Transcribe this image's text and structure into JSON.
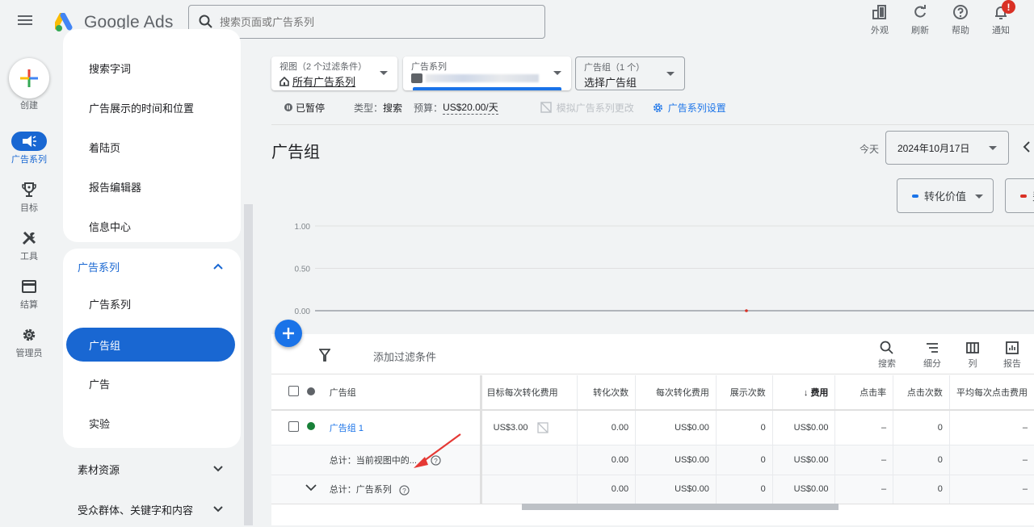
{
  "header": {
    "app_name": "Google Ads",
    "search_placeholder": "搜索页面或广告系列",
    "actions": [
      {
        "label": "外观",
        "icon": "appearance-icon"
      },
      {
        "label": "刷新",
        "icon": "refresh-icon"
      },
      {
        "label": "帮助",
        "icon": "help-icon"
      },
      {
        "label": "通知",
        "icon": "bell-icon",
        "badge": "!"
      }
    ]
  },
  "rail": {
    "create_label": "创建",
    "items": [
      {
        "label": "广告系列",
        "icon": "megaphone-icon",
        "active": true
      },
      {
        "label": "目标",
        "icon": "trophy-icon"
      },
      {
        "label": "工具",
        "icon": "tools-icon"
      },
      {
        "label": "结算",
        "icon": "billing-card-icon"
      },
      {
        "label": "管理员",
        "icon": "gear-icon"
      }
    ]
  },
  "nav": {
    "top_items": [
      "搜索字词",
      "广告展示的时间和位置",
      "着陆页",
      "报告编辑器",
      "信息中心"
    ],
    "section_title": "广告系列",
    "section_items": [
      "广告系列",
      "广告组",
      "广告",
      "实验"
    ],
    "active_item": "广告组",
    "collapsed_sections": [
      "素材资源",
      "受众群体、关键字和内容"
    ]
  },
  "selectors": {
    "view": {
      "caption": "视图（2 个过滤条件）",
      "value": "所有广告系列"
    },
    "campaign": {
      "caption": "广告系列",
      "value": ""
    },
    "adgroup": {
      "caption": "广告组（1 个）",
      "value": "选择广告组"
    }
  },
  "status": {
    "state": "已暂停",
    "type_label": "类型：",
    "type_value": "搜索",
    "budget_label": "预算：",
    "budget_value": "US$20.00/天",
    "simulate": "模拟广告系列更改",
    "settings": "广告系列设置"
  },
  "page": {
    "title": "广告组",
    "today_label": "今天",
    "date": "2024年10月17日"
  },
  "metrics": [
    {
      "label": "转化价值",
      "color": "#1a73e8"
    },
    {
      "label": "费",
      "color": "#d93025"
    }
  ],
  "chart_data": {
    "type": "line",
    "yticks": [
      "1.00",
      "0.50",
      "0.00"
    ],
    "ylim": [
      0,
      1
    ],
    "series": [
      {
        "name": "费用",
        "color": "#d93025",
        "values": [
          0
        ]
      }
    ],
    "point_x_fraction": 0.6
  },
  "toolbar": {
    "filter_placeholder": "添加过滤条件",
    "tools": [
      {
        "label": "搜索",
        "icon": "search-icon"
      },
      {
        "label": "细分",
        "icon": "segment-icon"
      },
      {
        "label": "列",
        "icon": "columns-icon"
      },
      {
        "label": "报告",
        "icon": "report-icon"
      }
    ]
  },
  "table": {
    "columns": [
      "广告组",
      "目标每次转化费用",
      "转化次数",
      "每次转化费用",
      "展示次数",
      "费用",
      "点击率",
      "点击次数",
      "平均每次点击费用"
    ],
    "sort_column": "费用",
    "rows": [
      {
        "name": "广告组 1",
        "status_color": "#188038",
        "target_cpa": "US$3.00",
        "conversions": "0.00",
        "cost_per_conv": "US$0.00",
        "impressions": "0",
        "cost": "US$0.00",
        "ctr": "–",
        "clicks": "0",
        "avg_cpc": "–"
      }
    ],
    "totals": [
      {
        "name": "总计：当前视图中的...",
        "target_cpa": "",
        "conversions": "0.00",
        "cost_per_conv": "US$0.00",
        "impressions": "0",
        "cost": "US$0.00",
        "ctr": "–",
        "clicks": "0",
        "avg_cpc": "–"
      },
      {
        "name": "总计：广告系列",
        "target_cpa": "",
        "conversions": "0.00",
        "cost_per_conv": "US$0.00",
        "impressions": "0",
        "cost": "US$0.00",
        "ctr": "–",
        "clicks": "0",
        "avg_cpc": "–"
      }
    ]
  }
}
